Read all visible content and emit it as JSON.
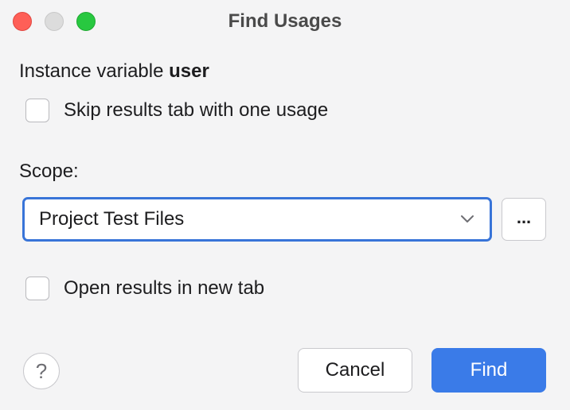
{
  "window": {
    "title": "Find Usages"
  },
  "header": {
    "prefix": "Instance variable",
    "name": "user"
  },
  "options": {
    "skip_results_tab": {
      "label": "Skip results tab with one usage",
      "checked": false
    },
    "open_in_new_tab": {
      "label": "Open results in new tab",
      "checked": false
    }
  },
  "scope": {
    "label": "Scope:",
    "selected": "Project Test Files",
    "more_label": "..."
  },
  "footer": {
    "help_label": "?",
    "cancel_label": "Cancel",
    "find_label": "Find"
  },
  "colors": {
    "accent": "#3a7be8",
    "focus_border": "#3874d8",
    "close": "#fe5f57",
    "minimize": "#dcdcdc",
    "zoom": "#28c840"
  },
  "icons": {
    "chevron": "chevron-down-icon"
  }
}
